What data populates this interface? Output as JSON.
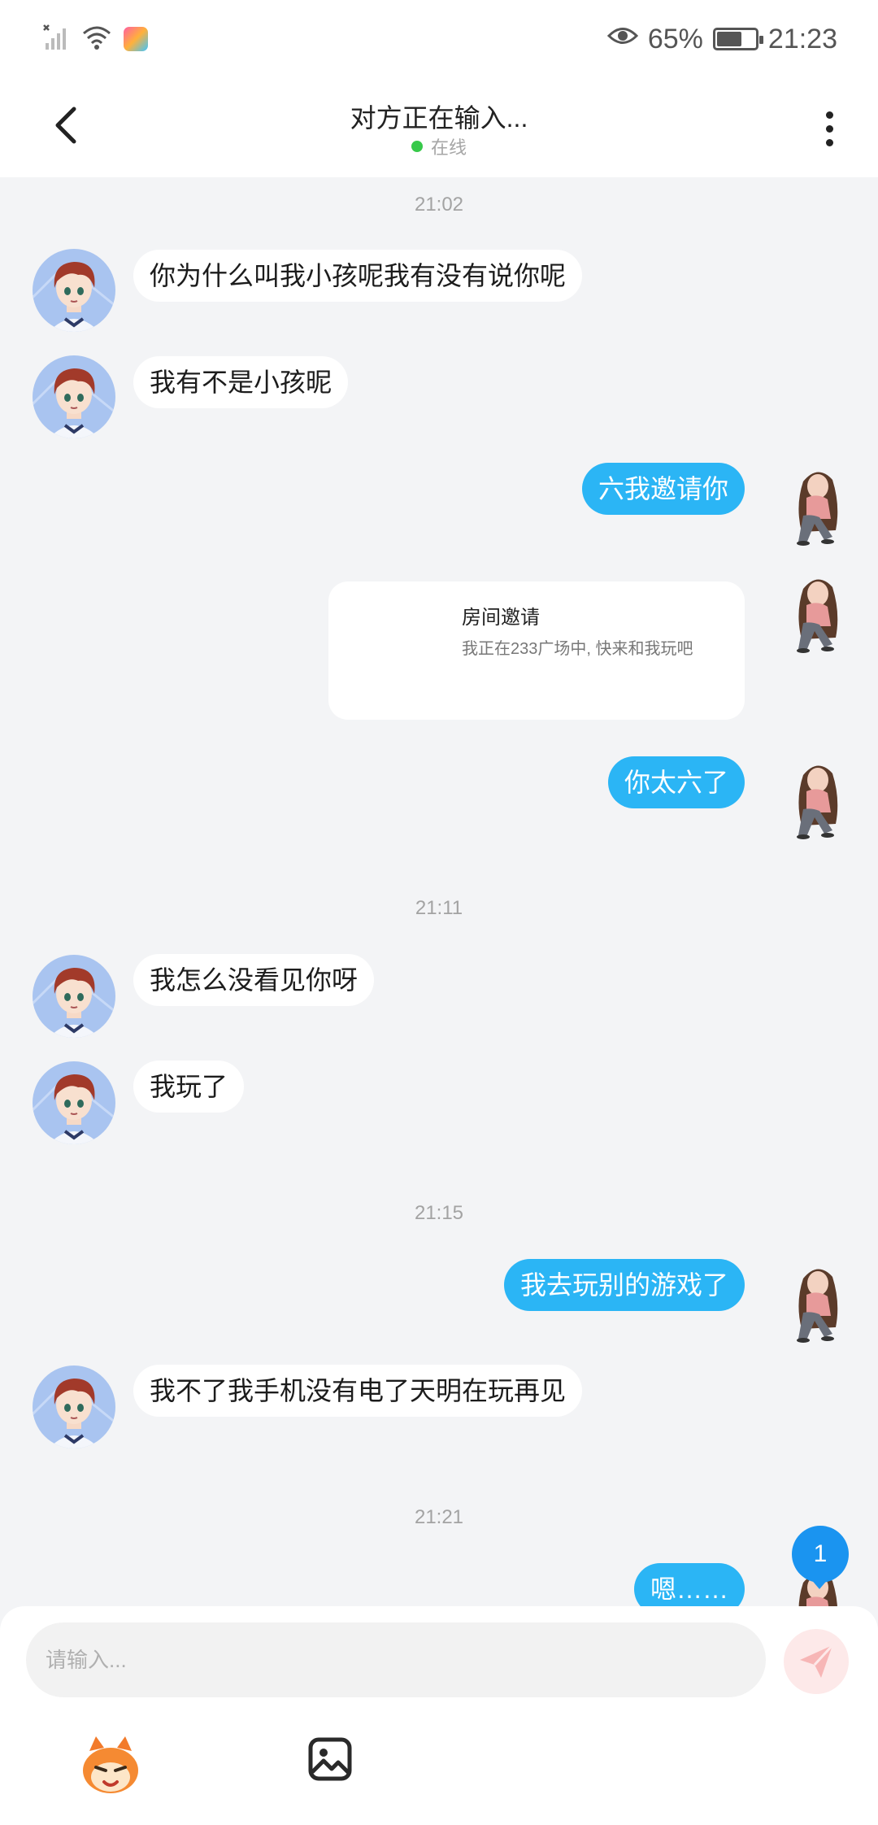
{
  "status_bar": {
    "battery_text": "65%",
    "battery_level": 0.65,
    "time": "21:23",
    "icons": [
      "no-sim-signal-icon",
      "wifi-icon",
      "app-notification-icon",
      "eye-icon",
      "battery-icon"
    ]
  },
  "header": {
    "title": "对方正在输入...",
    "status": "在线",
    "status_color": "#37c94a"
  },
  "chat": {
    "timestamps": [
      "21:02",
      "21:11",
      "21:15",
      "21:21"
    ],
    "messages": [
      {
        "side": "in",
        "text": "你为什么叫我小孩呢我有没有说你呢"
      },
      {
        "side": "in",
        "text": "我有不是小孩昵"
      },
      {
        "side": "out",
        "text": "六我邀请你"
      },
      {
        "side": "out",
        "type": "card",
        "title": "房间邀请",
        "desc": "我正在233广场中, 快来和我玩吧"
      },
      {
        "side": "out",
        "text": "你太六了"
      },
      {
        "side": "in",
        "text": "我怎么没看见你呀"
      },
      {
        "side": "in",
        "text": "我玩了"
      },
      {
        "side": "out",
        "text": "我去玩别的游戏了"
      },
      {
        "side": "in",
        "text": "我不了我手机没有电了天明在玩再见"
      },
      {
        "side": "out",
        "text": "嗯……"
      }
    ],
    "unread_count": "1"
  },
  "input": {
    "placeholder": "请输入..."
  },
  "colors": {
    "accent": "#2bb5f5",
    "background": "#f3f4f6",
    "badge": "#1a94f0"
  }
}
